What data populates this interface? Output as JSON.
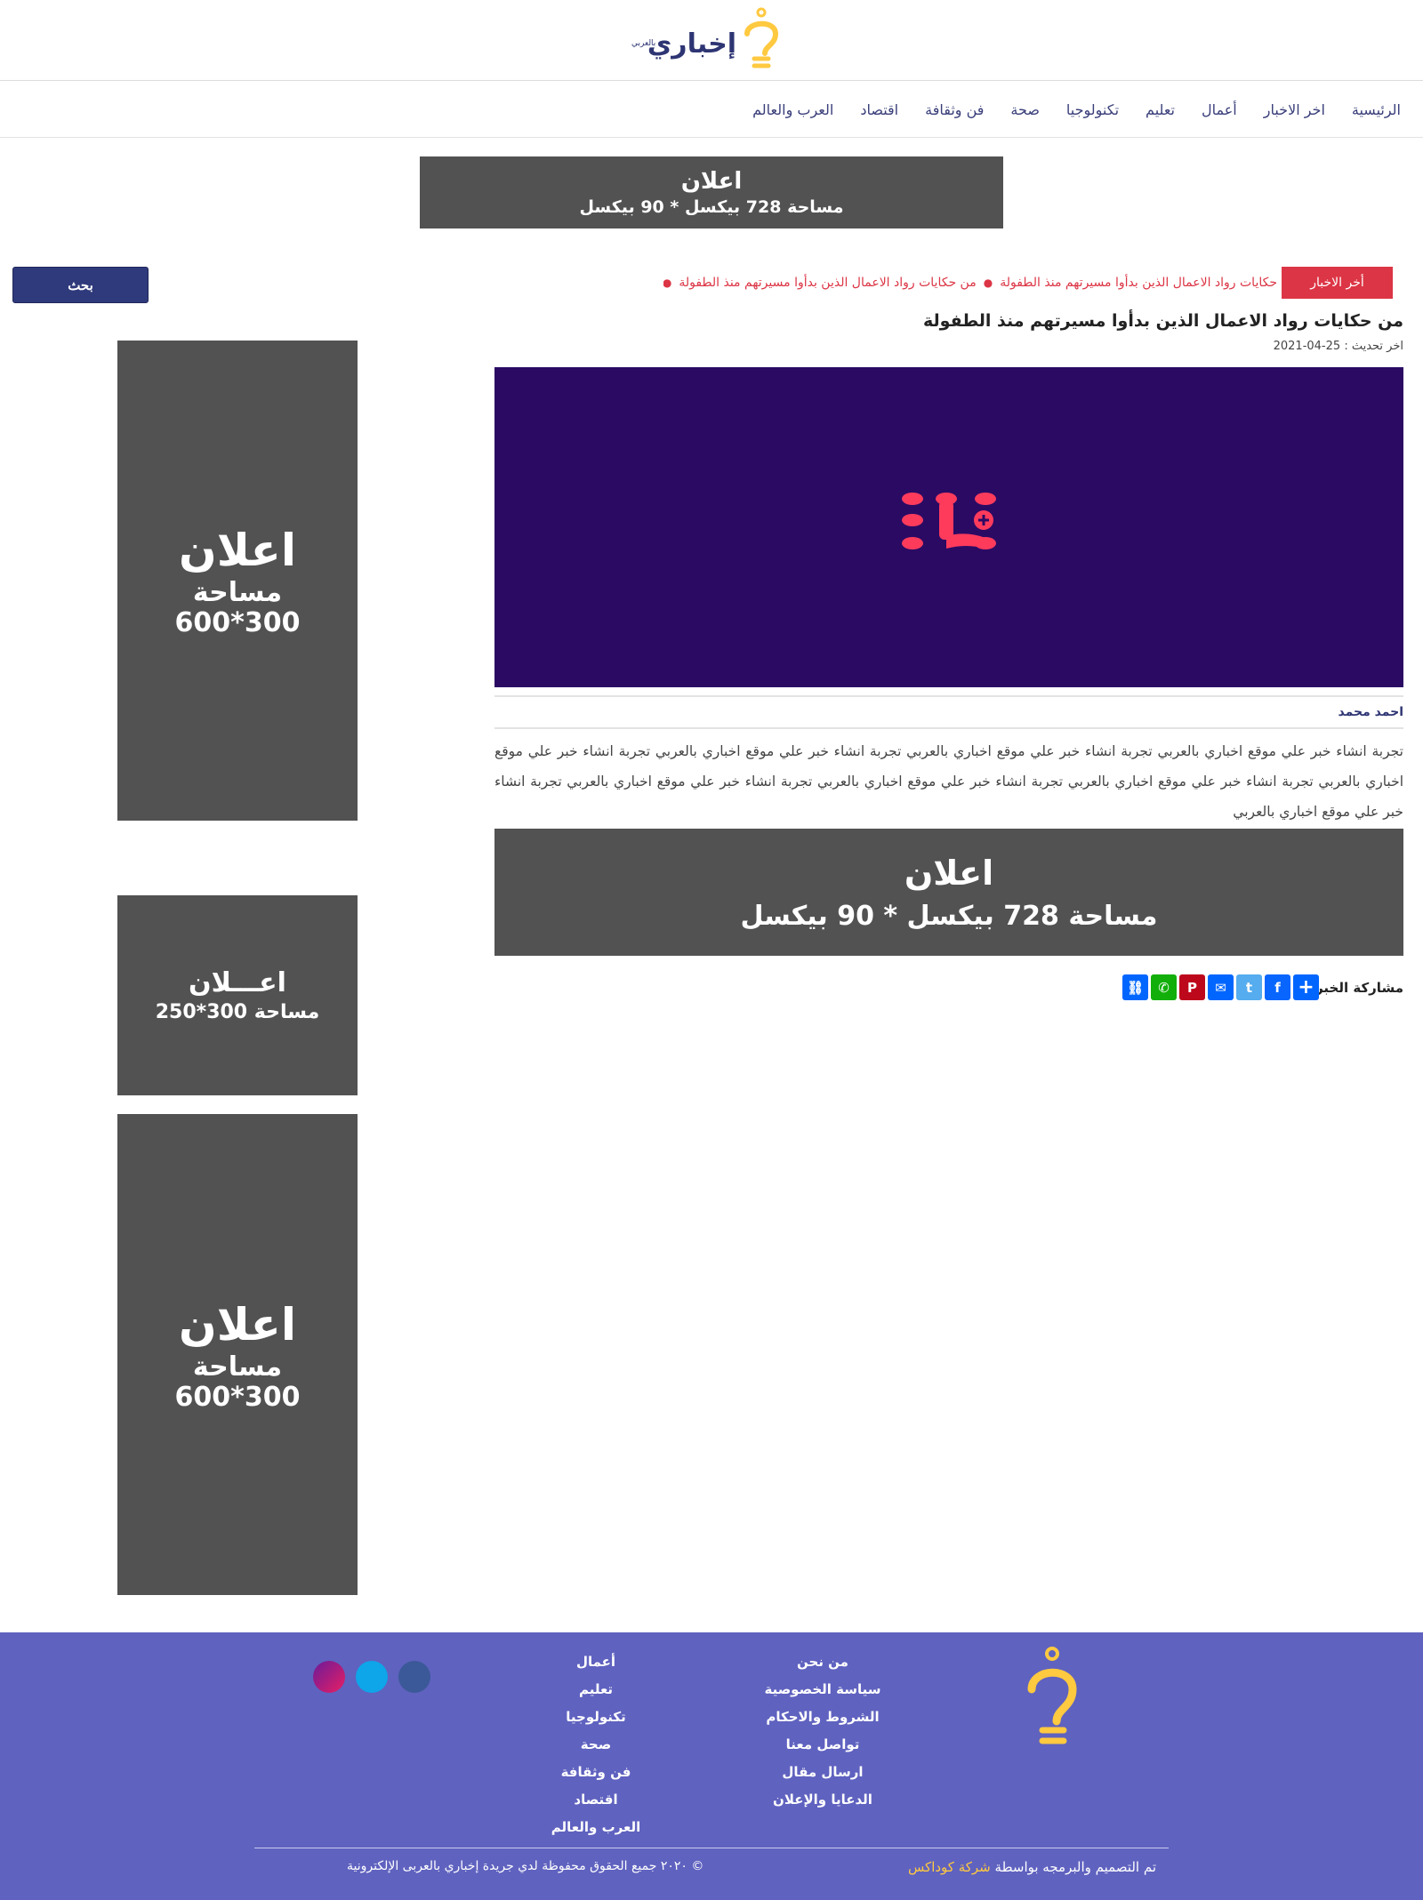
{
  "header": {
    "logo_text": "إخباري",
    "logo_sub": "بالعربي"
  },
  "nav": {
    "items": [
      {
        "label": "الرئيسية"
      },
      {
        "label": "اخر الاخبار"
      },
      {
        "label": "أعمال"
      },
      {
        "label": "تعليم"
      },
      {
        "label": "تكنولوجيا"
      },
      {
        "label": "صحة"
      },
      {
        "label": "فن وثقافة"
      },
      {
        "label": "اقتصاد"
      },
      {
        "label": "العرب والعالم"
      }
    ]
  },
  "ads": {
    "top": {
      "line1": "اعلان",
      "line2": "مساحة 728 بيكسل * 90 بيكسل"
    },
    "middle": {
      "line1": "اعلان",
      "line2": "مساحة 728 بيكسل * 90 بيكسل"
    },
    "side1": {
      "line1": "اعلان",
      "line2": "مساحة",
      "line3": "600*300"
    },
    "side2": {
      "line1": "اعـــلان",
      "line2": "مساحة 300*250"
    },
    "side3": {
      "line1": "اعلان",
      "line2": "مساحة",
      "line3": "600*300"
    }
  },
  "search": {
    "label": "بحث"
  },
  "ticker": {
    "label": "أخر الاخبار",
    "items": [
      "حكايات رواد الاعمال الذين بدأوا مسيرتهم منذ الطفولة",
      "من حكايات رواد الاعمال الذين بدأوا مسيرتهم منذ الطفولة"
    ]
  },
  "article": {
    "title": "من حكايات رواد الاعمال الذين بدأوا مسيرتهم منذ الطفولة",
    "date_label": "اخر تحديث :",
    "date_value": "2021-04-25",
    "author": "احمد محمد",
    "body": "تجربة انشاء خبر علي موقع اخباري بالعربي تجربة انشاء خبر علي موقع اخباري بالعربي تجربة انشاء خبر علي موقع اخباري بالعربي تجربة انشاء خبر علي موقع اخباري بالعربي تجربة انشاء خبر علي موقع اخباري بالعربي تجربة انشاء خبر علي موقع اخباري بالعربي تجربة انشاء خبر علي موقع اخباري بالعربي تجربة انشاء خبر علي موقع اخباري بالعربي"
  },
  "share": {
    "label": "مشاركة الخبر :",
    "icons": [
      {
        "name": "copy-link-icon",
        "color": "#0166ff",
        "glyph": "🔗"
      },
      {
        "name": "whatsapp-icon",
        "color": "#12af0a",
        "glyph": "✆"
      },
      {
        "name": "pinterest-icon",
        "color": "#bd081c",
        "glyph": "P"
      },
      {
        "name": "email-icon",
        "color": "#0166ff",
        "glyph": "✉"
      },
      {
        "name": "twitter-icon",
        "color": "#55acee",
        "glyph": "t"
      },
      {
        "name": "facebook-icon",
        "color": "#0866ff",
        "glyph": "f"
      },
      {
        "name": "more-share-icon",
        "color": "#0166ff",
        "glyph": "+"
      }
    ]
  },
  "footer": {
    "col1": [
      "من نحن",
      "سياسة الخصوصية",
      "الشروط والاحكام",
      "تواصل معنا",
      "ارسال مقال",
      "الدعايا والإعلان"
    ],
    "col2": [
      "أعمال",
      "تعليم",
      "تكنولوجيا",
      "صحة",
      "فن وثقافة",
      "اقتصاد",
      "العرب والعالم"
    ],
    "socials": [
      {
        "name": "facebook-icon",
        "color": "#3b5998"
      },
      {
        "name": "twitter-icon",
        "color": "#0ea5e9"
      },
      {
        "name": "instagram-icon",
        "color": "#c2185b"
      }
    ],
    "credit_prefix": "تم التصميم والبرمجه بواسطة",
    "credit_company": "شركة كوداكس",
    "copyright": "© ٢٠٢٠ جميع الحقوق محفوظة لدي جريدة إخباري بالعربى الإلكترونية"
  },
  "colors": {
    "brand": "#2e3573",
    "accent_yellow": "#ffc940",
    "ticker_red": "#dc3545",
    "footer_bg": "#5f62bf",
    "ad_bg": "#525252"
  }
}
